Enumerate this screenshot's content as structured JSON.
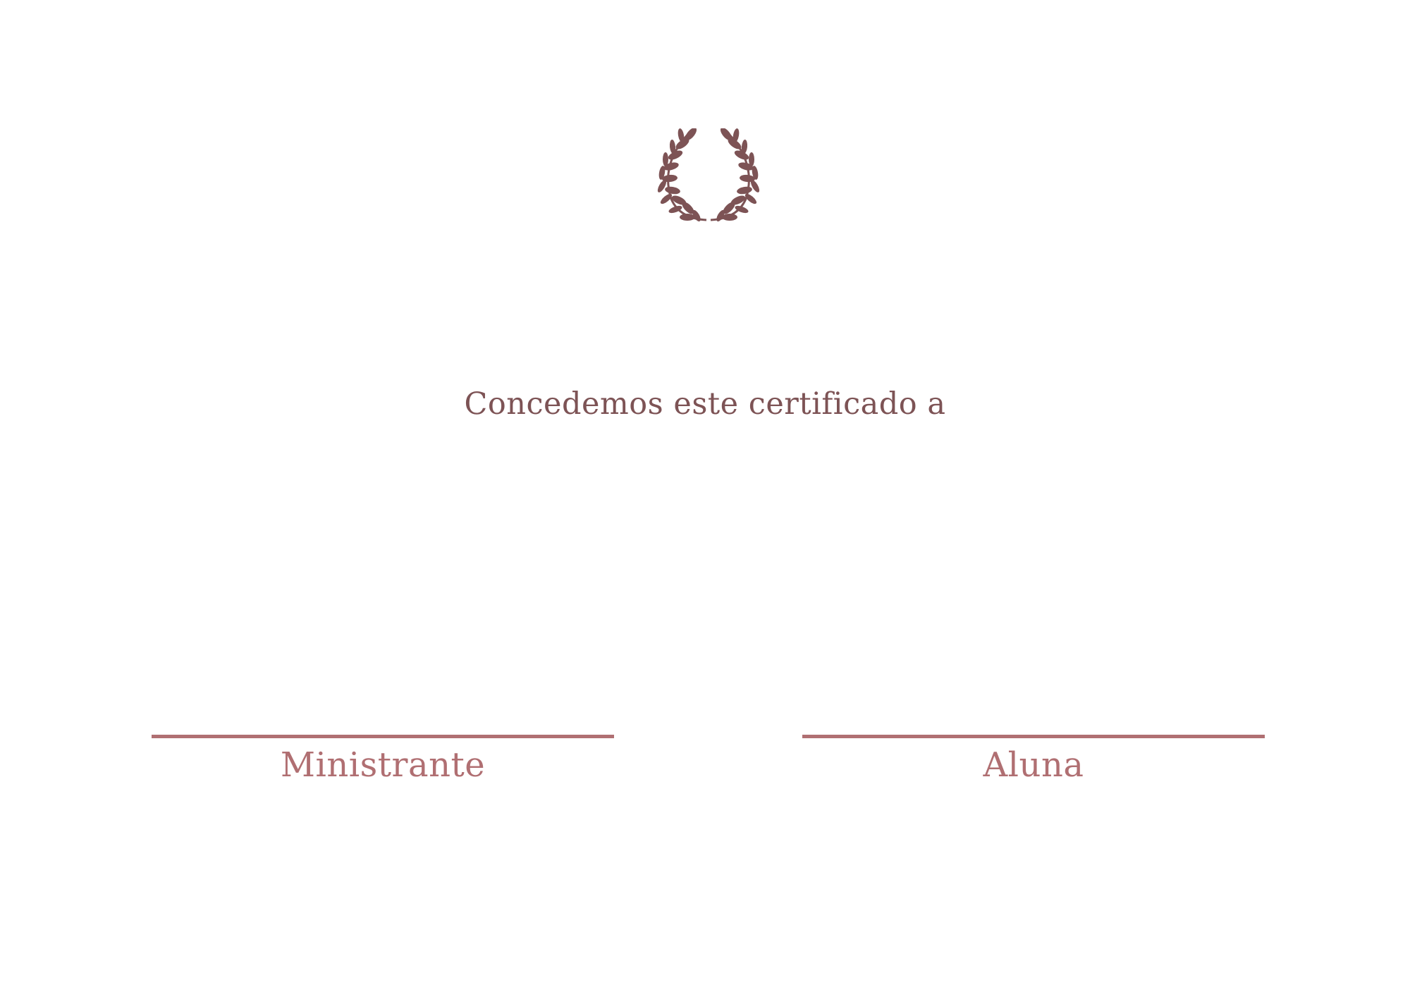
{
  "certificate": {
    "intro_text": "Concedemos este certificado a",
    "signatures": [
      {
        "label": "Ministrante"
      },
      {
        "label": "Aluna"
      }
    ],
    "emblem": "laurel-wreath-icon",
    "colors": {
      "text": "#7d5355",
      "accent": "#b06f72",
      "emblem": "#7d5355",
      "background": "#ffffff"
    }
  }
}
